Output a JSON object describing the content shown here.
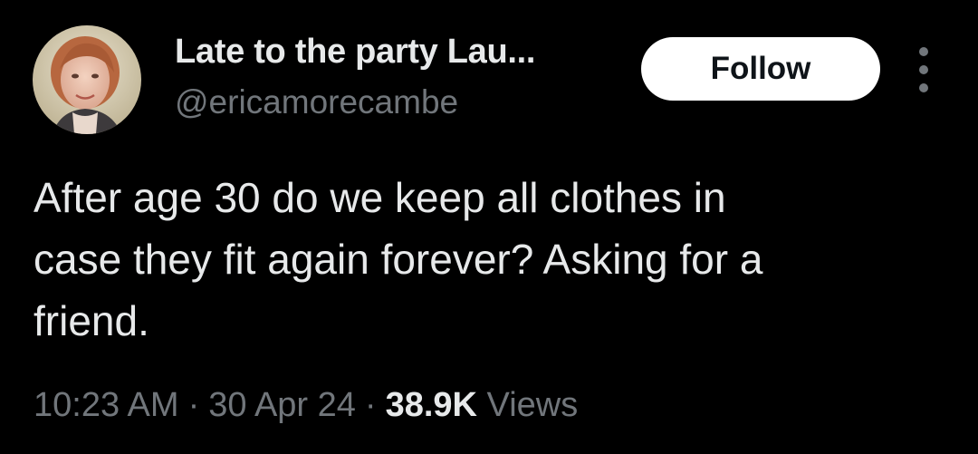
{
  "tweet": {
    "author": {
      "display_name": "Late to the party Lau...",
      "handle": "@ericamorecambe",
      "avatar_icon": "user-avatar-photo"
    },
    "follow_label": "Follow",
    "more_icon": "vertical-ellipsis-icon",
    "text_lines": [
      "After age 30 do we keep all clothes in",
      "case they fit again forever? Asking for a",
      "friend."
    ],
    "time": "10:23 AM",
    "date": "30 Apr 24",
    "separator": "·",
    "views_count": "38.9K",
    "views_label": "Views"
  },
  "colors": {
    "background": "#000000",
    "primary_text": "#e7e9ea",
    "secondary_text": "#71767b",
    "follow_bg": "#ffffff",
    "follow_text": "#0f1419"
  }
}
